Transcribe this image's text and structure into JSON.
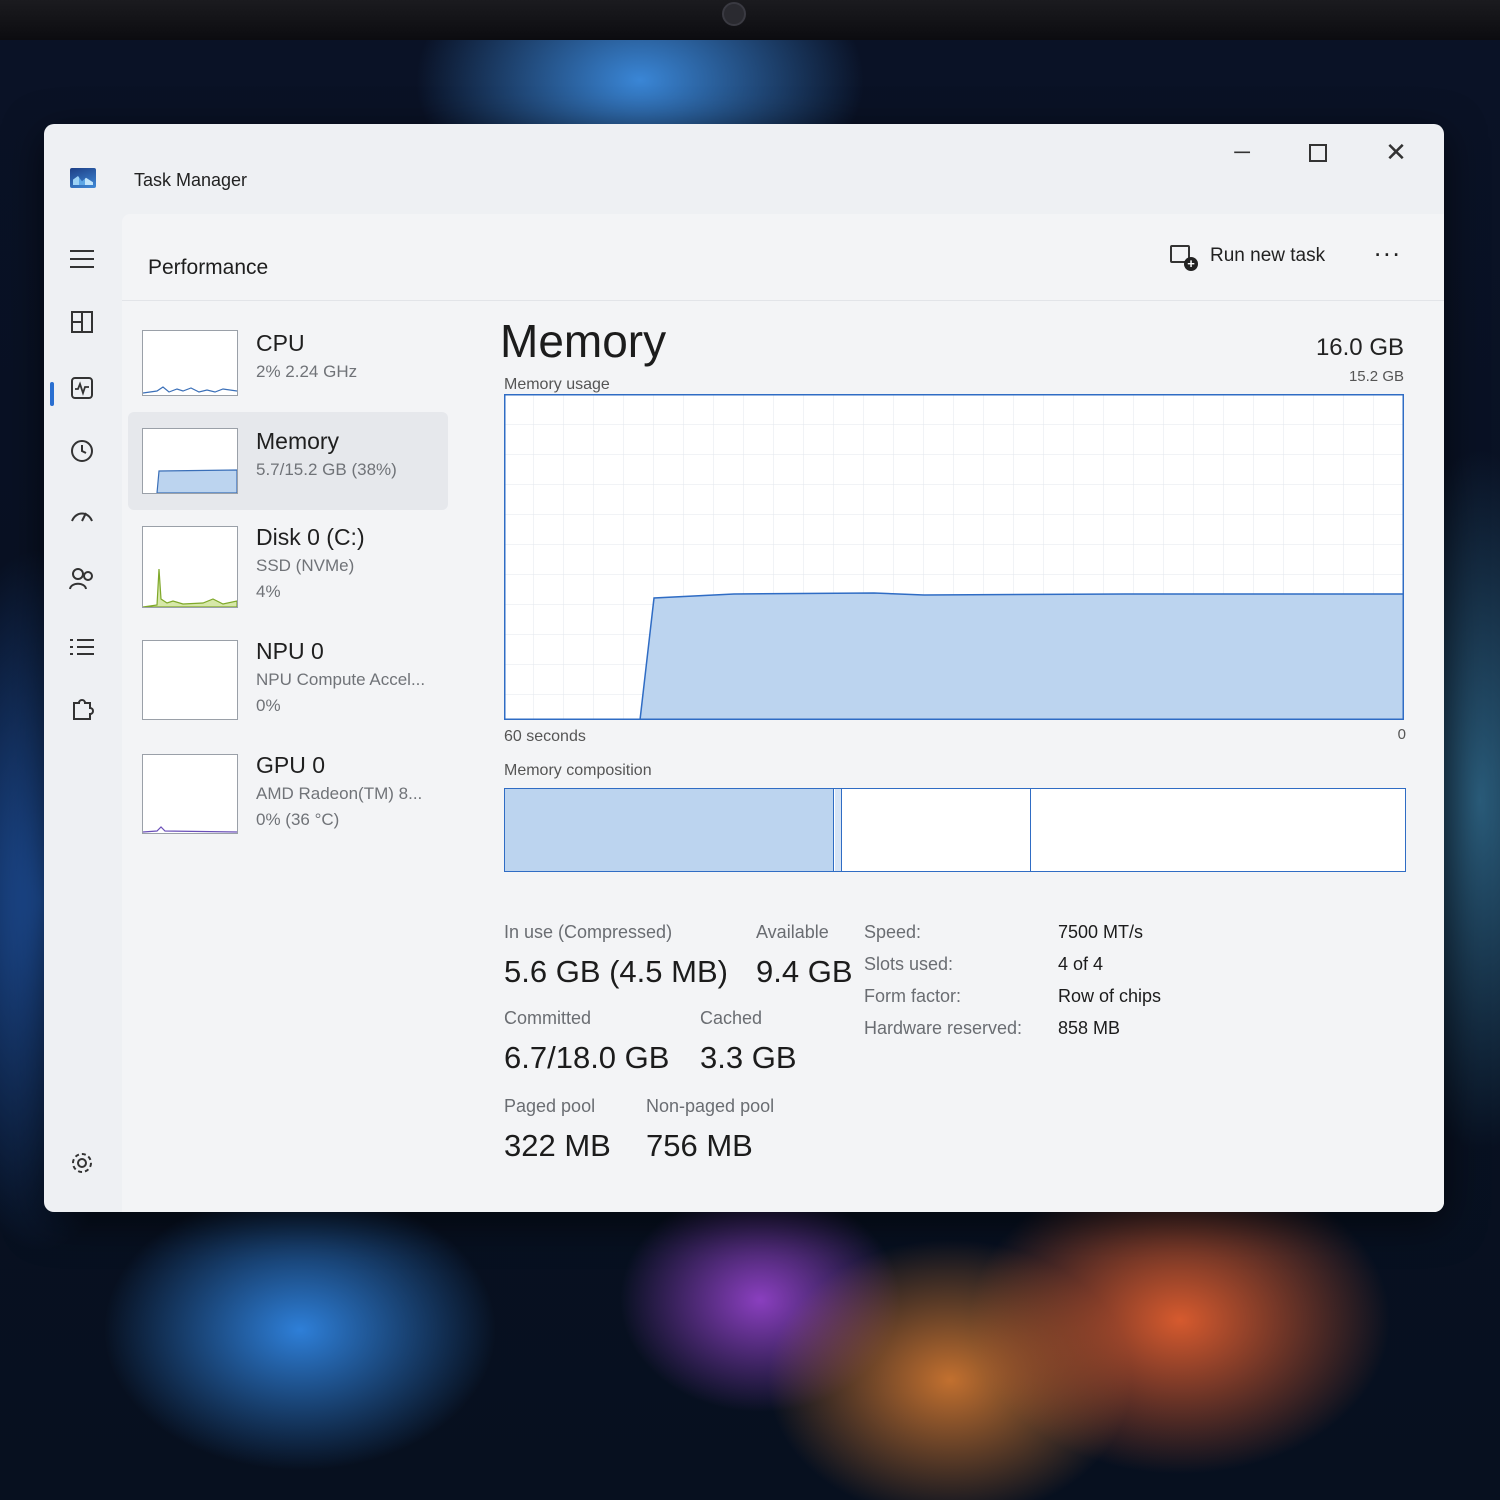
{
  "window": {
    "title": "Task Manager"
  },
  "header": {
    "page_title": "Performance",
    "run_new_task": "Run new task",
    "more": "..."
  },
  "rail": [
    "menu-icon",
    "processes-icon",
    "performance-icon",
    "app-history-icon",
    "startup-icon",
    "users-icon",
    "details-icon",
    "services-icon",
    "settings-icon"
  ],
  "devices": [
    {
      "name": "CPU",
      "line1": "2% 2.24 GHz",
      "line2": ""
    },
    {
      "name": "Memory",
      "line1": "5.7/15.2 GB (38%)",
      "line2": ""
    },
    {
      "name": "Disk 0 (C:)",
      "line1": "SSD (NVMe)",
      "line2": "4%"
    },
    {
      "name": "NPU 0",
      "line1": "NPU Compute Accel...",
      "line2": "0%"
    },
    {
      "name": "GPU 0",
      "line1": "AMD Radeon(TM) 8...",
      "line2": "0%  (36 °C)"
    }
  ],
  "memory": {
    "title": "Memory",
    "total": "16.0 GB",
    "usage_label": "Memory usage",
    "usage_max": "15.2 GB",
    "axis_left": "60 seconds",
    "axis_right": "0",
    "composition_label": "Memory composition",
    "stats": {
      "in_use_label": "In use (Compressed)",
      "in_use": "5.6 GB (4.5 MB)",
      "available_label": "Available",
      "available": "9.4 GB",
      "committed_label": "Committed",
      "committed": "6.7/18.0 GB",
      "cached_label": "Cached",
      "cached": "3.3 GB",
      "paged_label": "Paged pool",
      "paged": "322 MB",
      "nonpaged_label": "Non-paged pool",
      "nonpaged": "756 MB"
    },
    "specs": {
      "speed_label": "Speed:",
      "speed": "7500 MT/s",
      "slots_label": "Slots used:",
      "slots": "4 of 4",
      "form_label": "Form factor:",
      "form": "Row of chips",
      "reserved_label": "Hardware reserved:",
      "reserved": "858 MB"
    }
  },
  "colors": {
    "accent": "#2f6cc4",
    "fill": "#bcd4ef"
  }
}
